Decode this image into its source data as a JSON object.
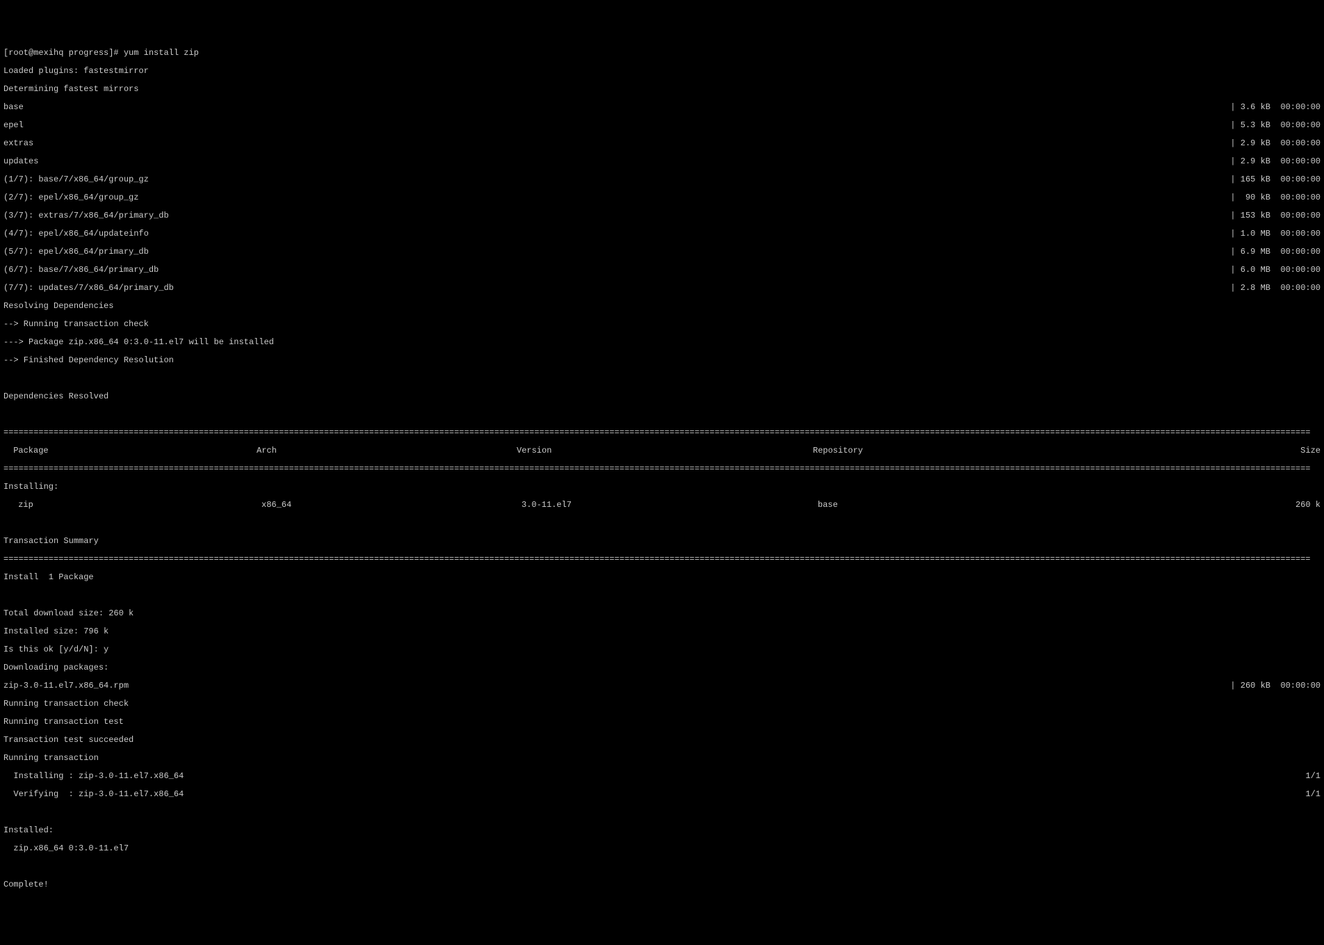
{
  "prompt": "[root@mexihq progress]# yum install zip",
  "plugins": "Loaded plugins: fastestmirror",
  "determining": "Determining fastest mirrors",
  "repos": [
    {
      "name": "base",
      "size": "| 3.6 kB  00:00:00"
    },
    {
      "name": "epel",
      "size": "| 5.3 kB  00:00:00"
    },
    {
      "name": "extras",
      "size": "| 2.9 kB  00:00:00"
    },
    {
      "name": "updates",
      "size": "| 2.9 kB  00:00:00"
    }
  ],
  "downloads": [
    {
      "name": "(1/7): base/7/x86_64/group_gz",
      "size": "| 165 kB  00:00:00"
    },
    {
      "name": "(2/7): epel/x86_64/group_gz",
      "size": "|  90 kB  00:00:00"
    },
    {
      "name": "(3/7): extras/7/x86_64/primary_db",
      "size": "| 153 kB  00:00:00"
    },
    {
      "name": "(4/7): epel/x86_64/updateinfo",
      "size": "| 1.0 MB  00:00:00"
    },
    {
      "name": "(5/7): epel/x86_64/primary_db",
      "size": "| 6.9 MB  00:00:00"
    },
    {
      "name": "(6/7): base/7/x86_64/primary_db",
      "size": "| 6.0 MB  00:00:00"
    },
    {
      "name": "(7/7): updates/7/x86_64/primary_db",
      "size": "| 2.8 MB  00:00:00"
    }
  ],
  "resolving": "Resolving Dependencies",
  "trans_check": "--> Running transaction check",
  "pkg_line": "---> Package zip.x86_64 0:3.0-11.el7 will be installed",
  "finished": "--> Finished Dependency Resolution",
  "dep_resolved": "Dependencies Resolved",
  "hr": "=====================================================================================================================================================================================================================================================================",
  "headers": {
    "pkg": " Package",
    "arch": "Arch",
    "ver": "Version",
    "repo": "Repository",
    "size": " Size"
  },
  "installing_hdr": "Installing:",
  "row": {
    "pkg": " zip",
    "arch": "x86_64",
    "ver": "3.0-11.el7",
    "repo": "base",
    "size": "260 k"
  },
  "txn_summary": "Transaction Summary",
  "install_count": "Install  1 Package",
  "dl_size": "Total download size: 260 k",
  "inst_size": "Installed size: 796 k",
  "confirm": "Is this ok [y/d/N]: y",
  "dl_pkgs": "Downloading packages:",
  "rpm_line": {
    "name": "zip-3.0-11.el7.x86_64.rpm",
    "size": "| 260 kB  00:00:00"
  },
  "run_check": "Running transaction check",
  "run_test": "Running transaction test",
  "test_ok": "Transaction test succeeded",
  "run_txn": "Running transaction",
  "installing_line": {
    "left": "  Installing : zip-3.0-11.el7.x86_64",
    "right": "1/1"
  },
  "verifying_line": {
    "left": "  Verifying  : zip-3.0-11.el7.x86_64",
    "right": "1/1"
  },
  "installed_hdr": "Installed:",
  "installed_pkg": "  zip.x86_64 0:3.0-11.el7",
  "complete": "Complete!"
}
